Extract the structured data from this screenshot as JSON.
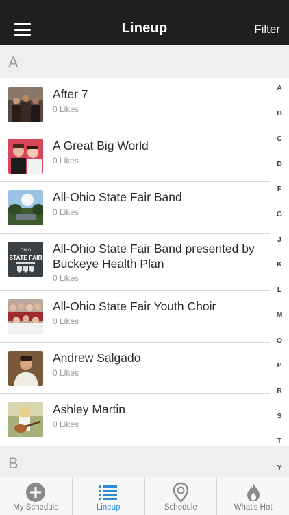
{
  "header": {
    "title": "Lineup",
    "filter_label": "Filter",
    "menu_icon": "hamburger-menu-icon"
  },
  "sections": [
    {
      "letter": "A"
    },
    {
      "letter": "B"
    }
  ],
  "artists": [
    {
      "name": "After 7",
      "likes": "0 Likes"
    },
    {
      "name": "A Great Big World",
      "likes": "0 Likes"
    },
    {
      "name": "All-Ohio State Fair Band",
      "likes": "0 Likes"
    },
    {
      "name": "All-Ohio State Fair Band presented by Buckeye Health Plan",
      "likes": "0 Likes",
      "thumb_text_top": "OHIO",
      "thumb_text_main": "STATE FAIR"
    },
    {
      "name": "All-Ohio State Fair Youth Choir",
      "likes": "0 Likes"
    },
    {
      "name": "Andrew Salgado",
      "likes": "0 Likes"
    },
    {
      "name": "Ashley Martin",
      "likes": "0 Likes"
    }
  ],
  "index": [
    "A",
    "B",
    "C",
    "D",
    "F",
    "G",
    "J",
    "K",
    "L",
    "M",
    "O",
    "P",
    "R",
    "S",
    "T",
    "Y"
  ],
  "tabs": [
    {
      "label": "My Schedule",
      "icon": "add-circle-icon"
    },
    {
      "label": "Lineup",
      "icon": "list-icon"
    },
    {
      "label": "Schedule",
      "icon": "location-pin-icon"
    },
    {
      "label": "What's Hot",
      "icon": "flame-icon"
    }
  ],
  "colors": {
    "header_bg": "#1f1f1f",
    "accent": "#2f8ad8",
    "section_bg": "#efefef"
  }
}
